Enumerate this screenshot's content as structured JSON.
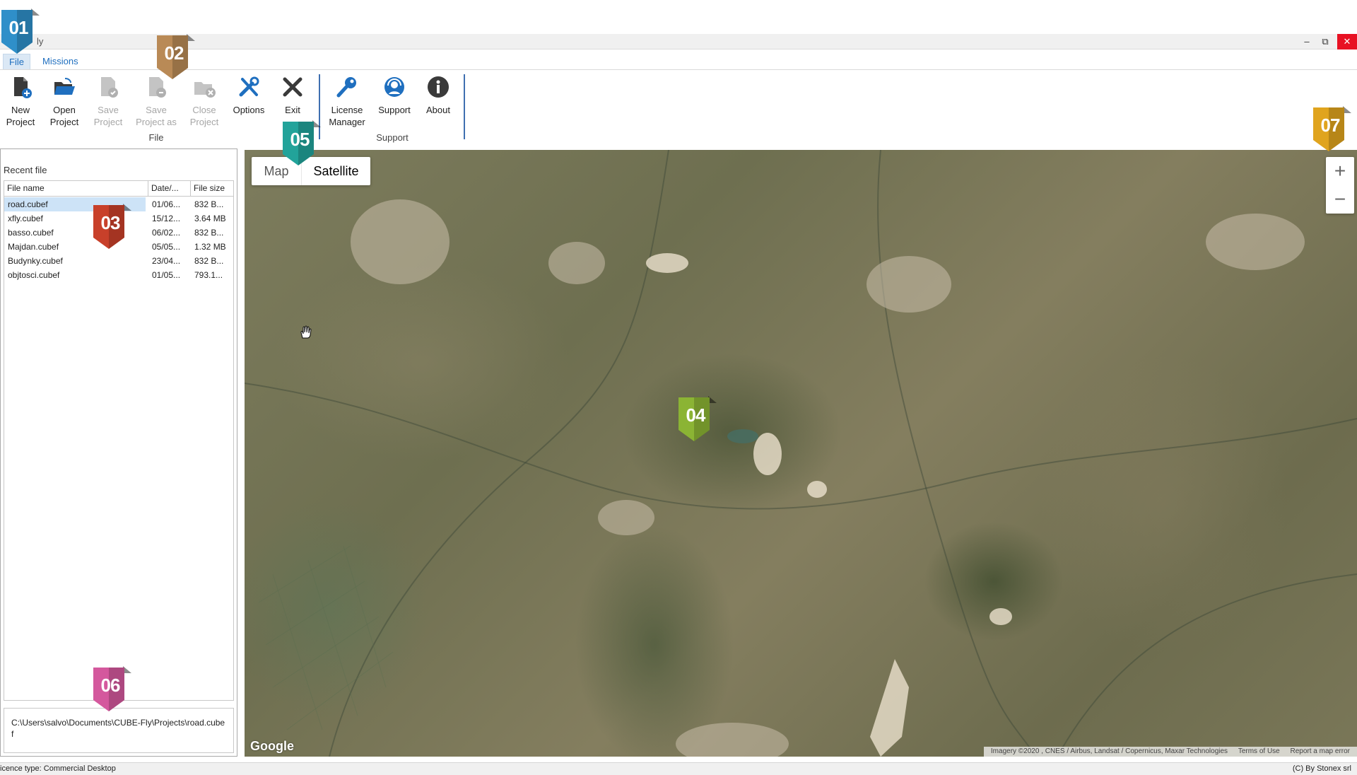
{
  "window": {
    "title": "ly",
    "minimize": "–",
    "restore": "⧉",
    "close": "✕"
  },
  "tabs": [
    {
      "label": "File"
    },
    {
      "label": "Missions"
    }
  ],
  "ribbon": {
    "buttons": [
      {
        "label": "New\nProject",
        "icon": "new-project-icon",
        "enabled": true
      },
      {
        "label": "Open\nProject",
        "icon": "open-project-icon",
        "enabled": true
      },
      {
        "label": "Save\nProject",
        "icon": "save-project-icon",
        "enabled": false
      },
      {
        "label": "Save\nProject as",
        "icon": "save-project-as-icon",
        "enabled": false
      },
      {
        "label": "Close\nProject",
        "icon": "close-project-icon",
        "enabled": false
      },
      {
        "label": "Options",
        "icon": "options-icon",
        "enabled": true
      },
      {
        "label": "Exit",
        "icon": "exit-icon",
        "enabled": true
      },
      {
        "label": "License\nManager",
        "icon": "license-key-icon",
        "enabled": true
      },
      {
        "label": "Support",
        "icon": "support-icon",
        "enabled": true
      },
      {
        "label": "About",
        "icon": "info-icon",
        "enabled": true
      }
    ],
    "groups": [
      {
        "label": "File"
      },
      {
        "label": "Support"
      }
    ]
  },
  "recent": {
    "title": "Recent file",
    "columns": [
      "File name",
      "Date/...",
      "File size"
    ],
    "rows": [
      {
        "name": "road.cubef",
        "date": "01/06...",
        "size": "832 B..."
      },
      {
        "name": "xfly.cubef",
        "date": "15/12...",
        "size": "3.64 MB"
      },
      {
        "name": "basso.cubef",
        "date": "06/02...",
        "size": "832 B..."
      },
      {
        "name": "Majdan.cubef",
        "date": "05/05...",
        "size": "1.32 MB"
      },
      {
        "name": "Budynky.cubef",
        "date": "23/04...",
        "size": "832 B..."
      },
      {
        "name": "objtosci.cubef",
        "date": "01/05...",
        "size": "793.1..."
      }
    ],
    "selected_index": 0,
    "path": "C:\\Users\\salvo\\Documents\\CUBE-Fly\\Projects\\road.cubef"
  },
  "map": {
    "type_options": [
      "Map",
      "Satellite"
    ],
    "selected_type": "Satellite",
    "zoom_in": "+",
    "zoom_out": "−",
    "logo": "Google",
    "attribution": "Imagery ©2020 , CNES / Airbus, Landsat / Copernicus, Maxar Technologies",
    "terms": "Terms of Use",
    "report": "Report a map error"
  },
  "status": {
    "left": "icence type: Commercial Desktop",
    "right": "(C) By Stonex srl"
  },
  "badges": [
    {
      "num": "01",
      "color": "#2f8fc9"
    },
    {
      "num": "02",
      "color": "#b98a56"
    },
    {
      "num": "03",
      "color": "#c8402a"
    },
    {
      "num": "04",
      "color": "#8bb434"
    },
    {
      "num": "05",
      "color": "#22a39a"
    },
    {
      "num": "06",
      "color": "#d4589d"
    },
    {
      "num": "07",
      "color": "#e0a41e"
    }
  ]
}
